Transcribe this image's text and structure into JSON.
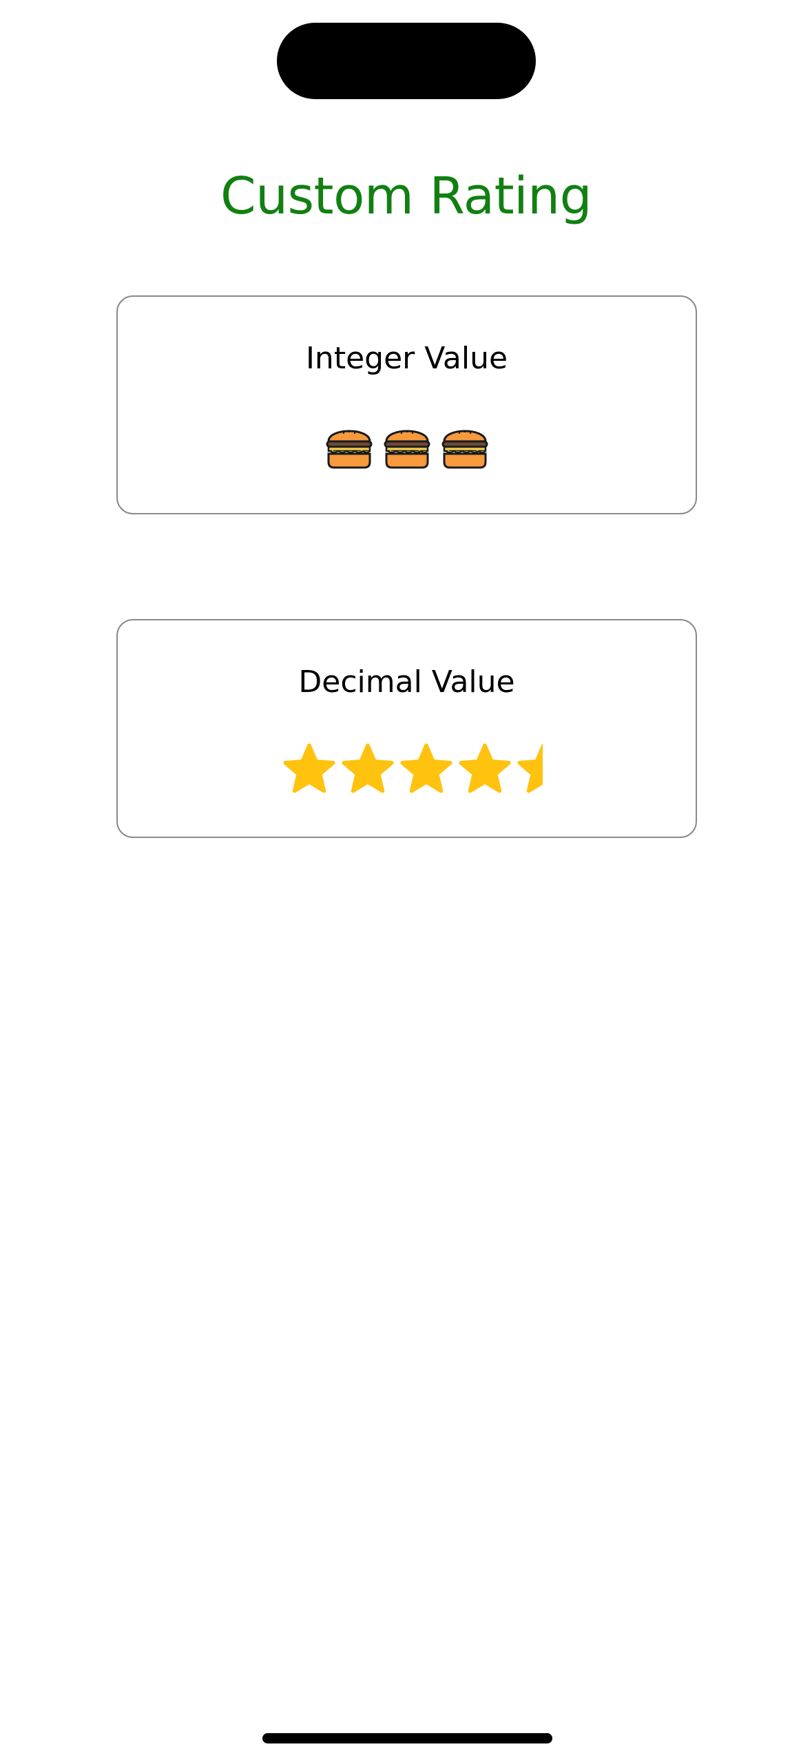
{
  "header": {
    "title": "Custom Rating"
  },
  "cards": {
    "integer": {
      "label": "Integer Value",
      "rating": 3,
      "icon": "burger-icon"
    },
    "decimal": {
      "label": "Decimal Value",
      "rating": 4.5,
      "icon": "star-icon"
    }
  },
  "colors": {
    "title": "#118011",
    "star": "#FFC20E",
    "card_border": "#8A8A8A"
  }
}
